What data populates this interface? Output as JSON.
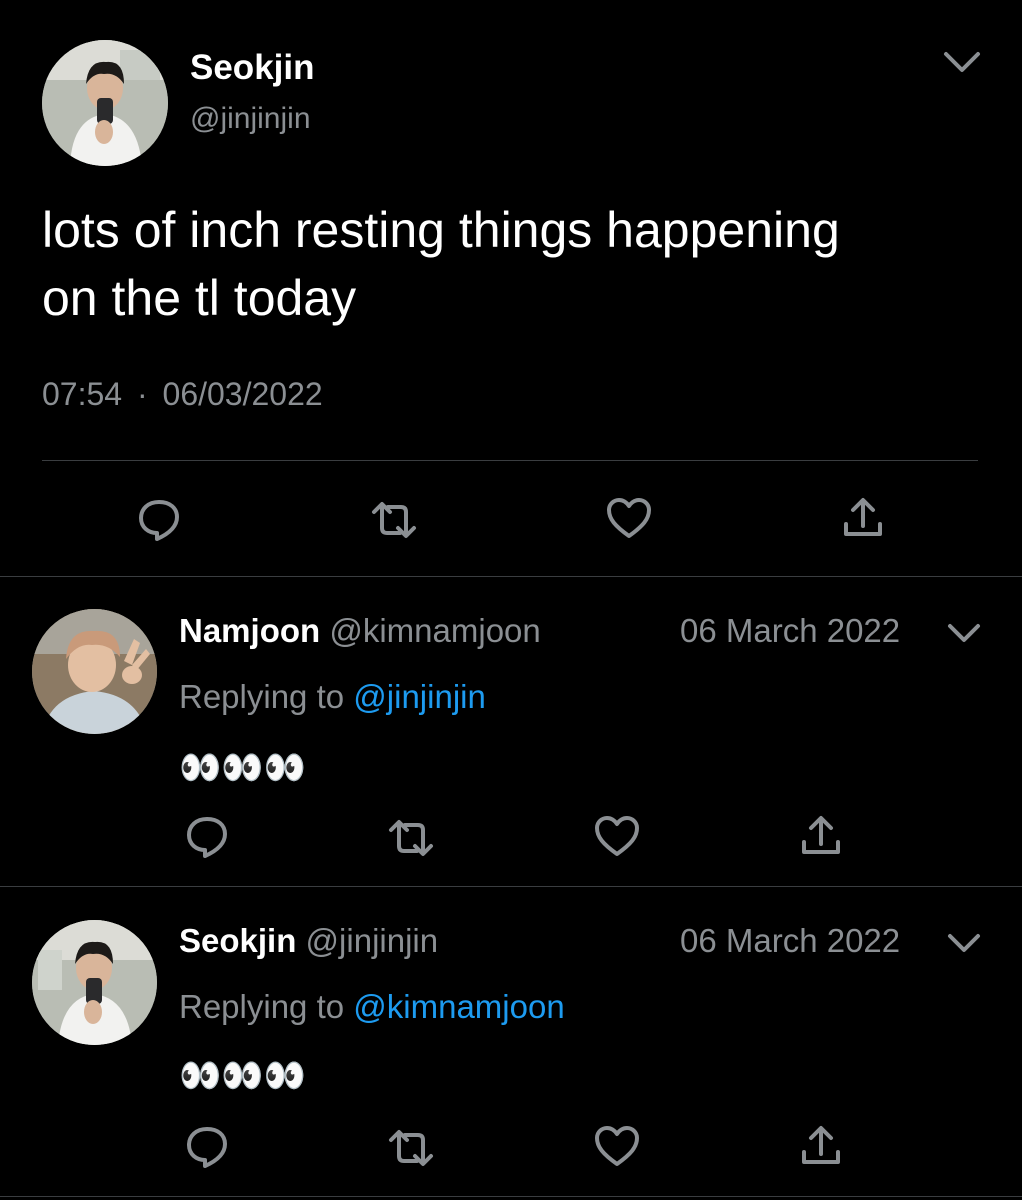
{
  "colors": {
    "background": "#000000",
    "text": "#e7e9ea",
    "muted": "#8b8f93",
    "link": "#1d9bf0",
    "divider": "#3a3d40"
  },
  "main_tweet": {
    "author_name": "Seokjin",
    "author_handle": "@jinjinjin",
    "text_line1": "lots of inch resting things happening",
    "text_line2": "on the tl today",
    "time": "07:54",
    "separator": "·",
    "date": "06/03/2022",
    "menu_icon": "chevron-down-icon",
    "actions": [
      "reply-icon",
      "retweet-icon",
      "like-icon",
      "share-icon"
    ]
  },
  "replies": [
    {
      "author_name": "Namjoon",
      "author_handle": "@kimnamjoon",
      "date": "06 March 2022",
      "replying_prefix": "Replying to",
      "replying_to": "@jinjinjin",
      "text": "👀👀👀"
    },
    {
      "author_name": "Seokjin",
      "author_handle": "@jinjinjin",
      "date": "06 March 2022",
      "replying_prefix": "Replying to",
      "replying_to": "@kimnamjoon",
      "text": "👀👀👀"
    }
  ]
}
